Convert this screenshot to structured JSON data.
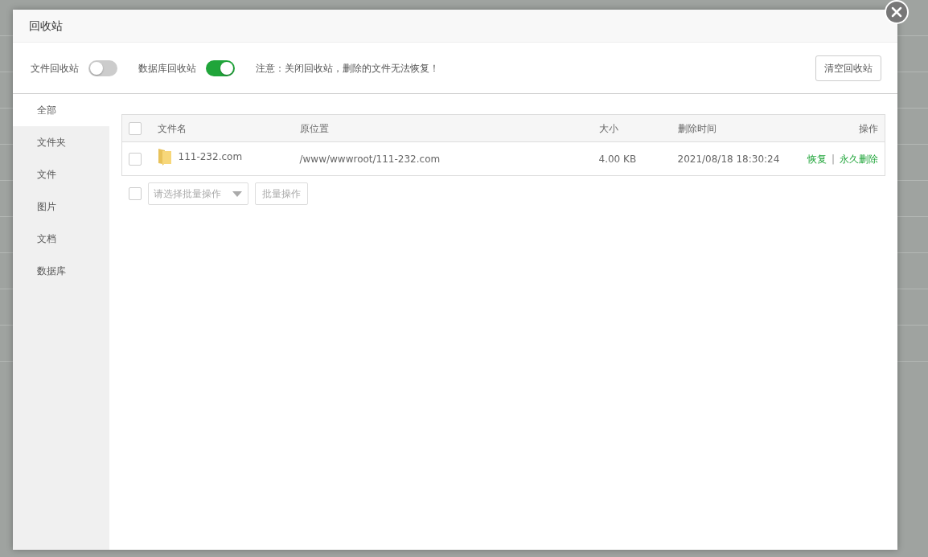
{
  "dialog": {
    "title": "回收站"
  },
  "toolbar": {
    "switches": [
      {
        "label": "文件回收站",
        "on": false
      },
      {
        "label": "数据库回收站",
        "on": true
      }
    ],
    "notice": "注意：关闭回收站，删除的文件无法恢复！",
    "clear_button": "清空回收站"
  },
  "sidebar": {
    "items": [
      {
        "label": "全部",
        "selected": true
      },
      {
        "label": "文件夹",
        "selected": false
      },
      {
        "label": "文件",
        "selected": false
      },
      {
        "label": "图片",
        "selected": false
      },
      {
        "label": "文档",
        "selected": false
      },
      {
        "label": "数据库",
        "selected": false
      }
    ]
  },
  "table": {
    "all_checked": false,
    "columns": [
      "文件名",
      "原位置",
      "大小",
      "删除时间",
      "操作"
    ],
    "rows": [
      {
        "checked": false,
        "kind": "folder",
        "name": "111-232.com",
        "location": "/www/wwwroot/111-232.com",
        "size": "4.00 KB",
        "deleted": "2021/08/18 18:30:24",
        "actions": [
          "恢复",
          "永久删除"
        ],
        "separator": "|"
      }
    ]
  },
  "batch": {
    "checked": false,
    "placeholder": "请选择批量操作",
    "button": "批量操作"
  }
}
